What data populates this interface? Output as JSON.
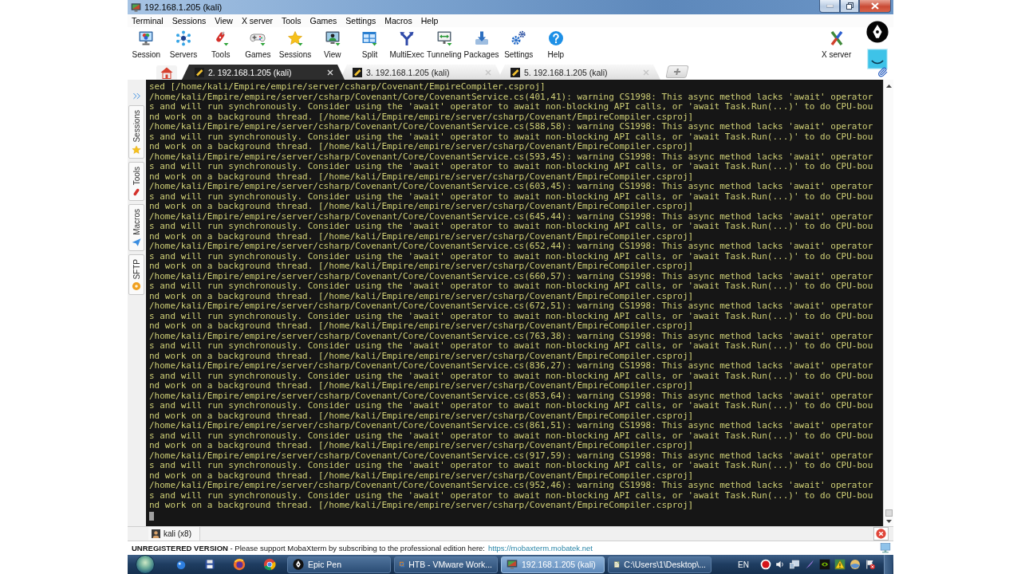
{
  "window": {
    "title": "192.168.1.205 (kali)"
  },
  "menu": [
    "Terminal",
    "Sessions",
    "View",
    "X server",
    "Tools",
    "Games",
    "Settings",
    "Macros",
    "Help"
  ],
  "toolbar": {
    "items": [
      "Session",
      "Servers",
      "Tools",
      "Games",
      "Sessions",
      "View",
      "Split",
      "MultiExec",
      "Tunneling",
      "Packages",
      "Settings",
      "Help"
    ],
    "right_item": "X server"
  },
  "tabs": [
    {
      "label": "2. 192.168.1.205 (kali)",
      "selected": true
    },
    {
      "label": "3. 192.168.1.205 (kali)",
      "selected": false
    },
    {
      "label": "5. 192.168.1.205 (kali)",
      "selected": false
    }
  ],
  "sidebar": {
    "tabs": [
      "Sessions",
      "Tools",
      "Macros",
      "SFTP"
    ]
  },
  "terminal": {
    "lines": [
      "sed [/home/kali/Empire/empire/server/csharp/Covenant/EmpireCompiler.csproj]",
      "/home/kali/Empire/empire/server/csharp/Covenant/Core/CovenantService.cs(401,41): warning CS1998: This async method lacks 'await' operator",
      "s and will run synchronously. Consider using the 'await' operator to await non-blocking API calls, or 'await Task.Run(...)' to do CPU-bou",
      "nd work on a background thread. [/home/kali/Empire/empire/server/csharp/Covenant/EmpireCompiler.csproj]",
      "/home/kali/Empire/empire/server/csharp/Covenant/Core/CovenantService.cs(588,58): warning CS1998: This async method lacks 'await' operator",
      "s and will run synchronously. Consider using the 'await' operator to await non-blocking API calls, or 'await Task.Run(...)' to do CPU-bou",
      "nd work on a background thread. [/home/kali/Empire/empire/server/csharp/Covenant/EmpireCompiler.csproj]",
      "/home/kali/Empire/empire/server/csharp/Covenant/Core/CovenantService.cs(593,45): warning CS1998: This async method lacks 'await' operator",
      "s and will run synchronously. Consider using the 'await' operator to await non-blocking API calls, or 'await Task.Run(...)' to do CPU-bou",
      "nd work on a background thread. [/home/kali/Empire/empire/server/csharp/Covenant/EmpireCompiler.csproj]",
      "/home/kali/Empire/empire/server/csharp/Covenant/Core/CovenantService.cs(603,45): warning CS1998: This async method lacks 'await' operator",
      "s and will run synchronously. Consider using the 'await' operator to await non-blocking API calls, or 'await Task.Run(...)' to do CPU-bou",
      "nd work on a background thread. [/home/kali/Empire/empire/server/csharp/Covenant/EmpireCompiler.csproj]",
      "/home/kali/Empire/empire/server/csharp/Covenant/Core/CovenantService.cs(645,44): warning CS1998: This async method lacks 'await' operator",
      "s and will run synchronously. Consider using the 'await' operator to await non-blocking API calls, or 'await Task.Run(...)' to do CPU-bou",
      "nd work on a background thread. [/home/kali/Empire/empire/server/csharp/Covenant/EmpireCompiler.csproj]",
      "/home/kali/Empire/empire/server/csharp/Covenant/Core/CovenantService.cs(652,44): warning CS1998: This async method lacks 'await' operator",
      "s and will run synchronously. Consider using the 'await' operator to await non-blocking API calls, or 'await Task.Run(...)' to do CPU-bou",
      "nd work on a background thread. [/home/kali/Empire/empire/server/csharp/Covenant/EmpireCompiler.csproj]",
      "/home/kali/Empire/empire/server/csharp/Covenant/Core/CovenantService.cs(660,57): warning CS1998: This async method lacks 'await' operator",
      "s and will run synchronously. Consider using the 'await' operator to await non-blocking API calls, or 'await Task.Run(...)' to do CPU-bou",
      "nd work on a background thread. [/home/kali/Empire/empire/server/csharp/Covenant/EmpireCompiler.csproj]",
      "/home/kali/Empire/empire/server/csharp/Covenant/Core/CovenantService.cs(672,51): warning CS1998: This async method lacks 'await' operator",
      "s and will run synchronously. Consider using the 'await' operator to await non-blocking API calls, or 'await Task.Run(...)' to do CPU-bou",
      "nd work on a background thread. [/home/kali/Empire/empire/server/csharp/Covenant/EmpireCompiler.csproj]",
      "/home/kali/Empire/empire/server/csharp/Covenant/Core/CovenantService.cs(763,38): warning CS1998: This async method lacks 'await' operator",
      "s and will run synchronously. Consider using the 'await' operator to await non-blocking API calls, or 'await Task.Run(...)' to do CPU-bou",
      "nd work on a background thread. [/home/kali/Empire/empire/server/csharp/Covenant/EmpireCompiler.csproj]",
      "/home/kali/Empire/empire/server/csharp/Covenant/Core/CovenantService.cs(836,27): warning CS1998: This async method lacks 'await' operator",
      "s and will run synchronously. Consider using the 'await' operator to await non-blocking API calls, or 'await Task.Run(...)' to do CPU-bou",
      "nd work on a background thread. [/home/kali/Empire/empire/server/csharp/Covenant/EmpireCompiler.csproj]",
      "/home/kali/Empire/empire/server/csharp/Covenant/Core/CovenantService.cs(853,64): warning CS1998: This async method lacks 'await' operator",
      "s and will run synchronously. Consider using the 'await' operator to await non-blocking API calls, or 'await Task.Run(...)' to do CPU-bou",
      "nd work on a background thread. [/home/kali/Empire/empire/server/csharp/Covenant/EmpireCompiler.csproj]",
      "/home/kali/Empire/empire/server/csharp/Covenant/Core/CovenantService.cs(861,51): warning CS1998: This async method lacks 'await' operator",
      "s and will run synchronously. Consider using the 'await' operator to await non-blocking API calls, or 'await Task.Run(...)' to do CPU-bou",
      "nd work on a background thread. [/home/kali/Empire/empire/server/csharp/Covenant/EmpireCompiler.csproj]",
      "/home/kali/Empire/empire/server/csharp/Covenant/Core/CovenantService.cs(917,59): warning CS1998: This async method lacks 'await' operator",
      "s and will run synchronously. Consider using the 'await' operator to await non-blocking API calls, or 'await Task.Run(...)' to do CPU-bou",
      "nd work on a background thread. [/home/kali/Empire/empire/server/csharp/Covenant/EmpireCompiler.csproj]",
      "/home/kali/Empire/empire/server/csharp/Covenant/Core/CovenantService.cs(952,46): warning CS1998: This async method lacks 'await' operator",
      "s and will run synchronously. Consider using the 'await' operator to await non-blocking API calls, or 'await Task.Run(...)' to do CPU-bou",
      "nd work on a background thread. [/home/kali/Empire/empire/server/csharp/Covenant/EmpireCompiler.csproj]"
    ]
  },
  "session_bar": {
    "label": "kali (x8)"
  },
  "status_bar": {
    "message": "**UNREGISTERED VERSION** - Please support MobaXterm by subscribing to the professional edition here:",
    "link": "https://mobaxterm.mobatek.net"
  },
  "taskbar": {
    "tasks": [
      {
        "label": "Epic Pen",
        "selected": false
      },
      {
        "label": "HTB - VMware Work...",
        "selected": false
      },
      {
        "label": "192.168.1.205 (kali)",
        "selected": true
      },
      {
        "label": "C:\\Users\\1\\Desktop\\...",
        "selected": false
      }
    ],
    "language": "EN"
  }
}
